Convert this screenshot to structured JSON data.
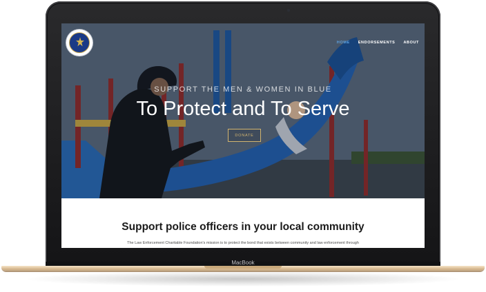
{
  "device": {
    "brand_label": "MacBook"
  },
  "website": {
    "logo": {
      "icon": "police-badge-icon"
    },
    "nav": [
      {
        "label": "HOME",
        "active": true
      },
      {
        "label": "ENDORSEMENTS",
        "active": false
      },
      {
        "label": "ABOUT",
        "active": false
      }
    ],
    "hero": {
      "eyebrow": "SUPPORT THE MEN & WOMEN IN BLUE",
      "title": "To Protect and To Serve",
      "donate_label": "DONATE"
    },
    "content": {
      "title": "Support police officers in your local community",
      "body": "The Law Enforcement Charitable Foundation's mission is to protect the bond that exists between community and law enforcement through"
    }
  },
  "colors": {
    "nav_active": "#5da3e3",
    "donate_border": "#d3b570",
    "hero_blue": "#1f5fae"
  }
}
